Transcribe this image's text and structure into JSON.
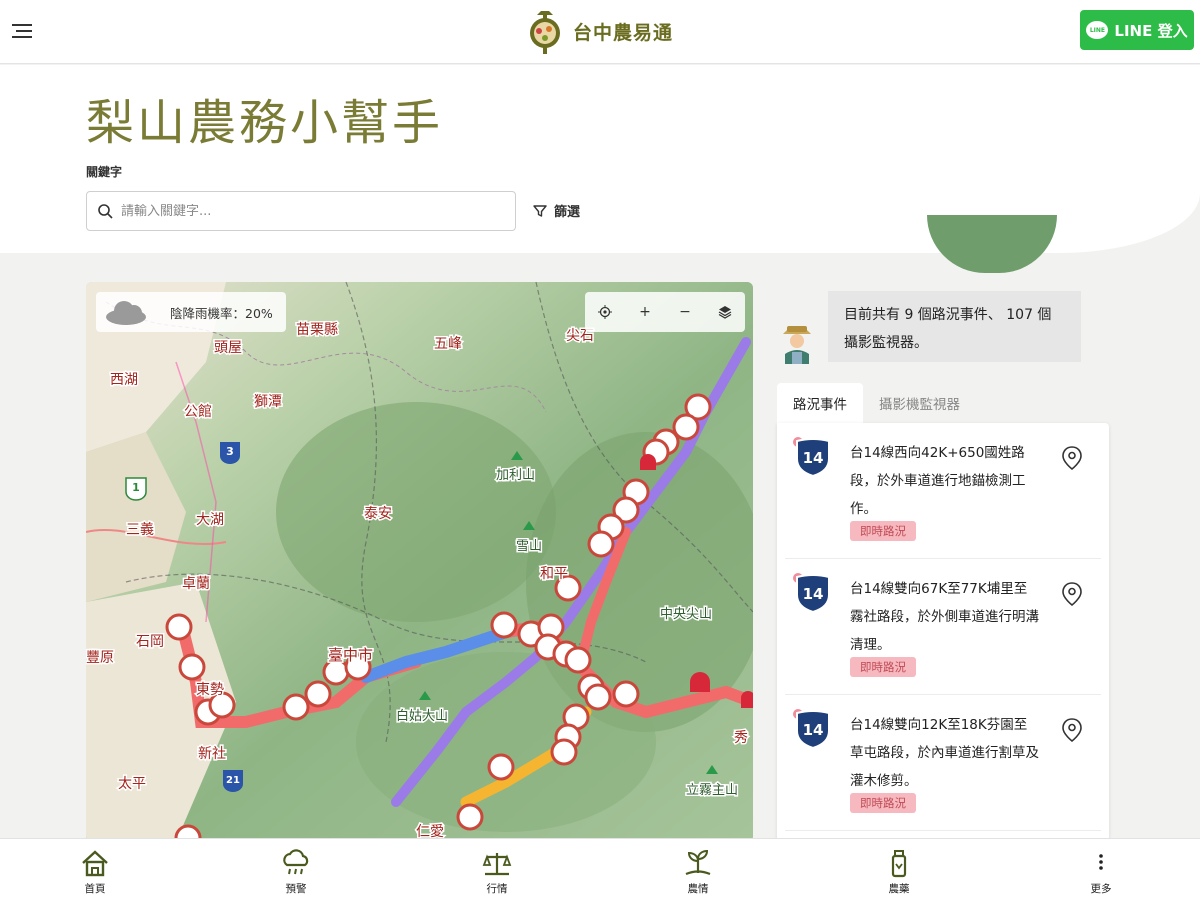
{
  "header": {
    "menu_icon": "hamburger-menu-icon",
    "brand_name": "台中農易通",
    "login_button": "LINE 登入"
  },
  "page": {
    "title": "梨山農務小幫手",
    "keyword_label": "關鍵字",
    "search_placeholder": "請輸入關鍵字...",
    "filter_label": "篩選"
  },
  "map": {
    "rain_text": "陰降雨機率：20%",
    "place_labels": [
      "苗栗縣",
      "頭屋",
      "五峰",
      "尖石",
      "西湖",
      "獅潭",
      "公館",
      "加利山",
      "泰安",
      "大湖",
      "三義",
      "雪山",
      "和平",
      "卓蘭",
      "中央尖山",
      "石岡",
      "豐原",
      "臺中市",
      "東勢",
      "新社",
      "白姑大山",
      "太平",
      "立霧主山",
      "仁愛",
      "秀"
    ],
    "route_shields": [
      "3",
      "1",
      "21"
    ],
    "tools": [
      "locate-icon",
      "zoom-in-icon",
      "zoom-out-icon",
      "layers-icon"
    ],
    "colors": {
      "route_red": "#f26b6b",
      "route_blue": "#5b8ee8",
      "route_purple": "#9a7be8",
      "route_orange": "#f5b530"
    }
  },
  "info": {
    "summary": "目前共有 9 個路況事件、 107 個攝影監視器。",
    "tabs": [
      "路況事件",
      "攝影機監視器"
    ],
    "events": [
      {
        "route": "14",
        "text": "台14線西向42K+650國姓路段，於外車道進行地錨檢測工作。",
        "badge": "即時路況"
      },
      {
        "route": "14",
        "text": "台14線雙向67K至77K埔里至霧社路段，於外側車道進行明溝清理。",
        "badge": "即時路況"
      },
      {
        "route": "14",
        "text": "台14線雙向12K至18K芬園至草屯路段，於內車道進行割草及灌木修剪。",
        "badge": "即時路況"
      }
    ]
  },
  "bottom_nav": [
    {
      "label": "首頁",
      "icon": "home-icon"
    },
    {
      "label": "預警",
      "icon": "weather-alert-icon"
    },
    {
      "label": "行情",
      "icon": "market-price-icon"
    },
    {
      "label": "農情",
      "icon": "crop-info-icon"
    },
    {
      "label": "農藥",
      "icon": "pesticide-icon"
    },
    {
      "label": "更多",
      "icon": "more-icon"
    }
  ]
}
